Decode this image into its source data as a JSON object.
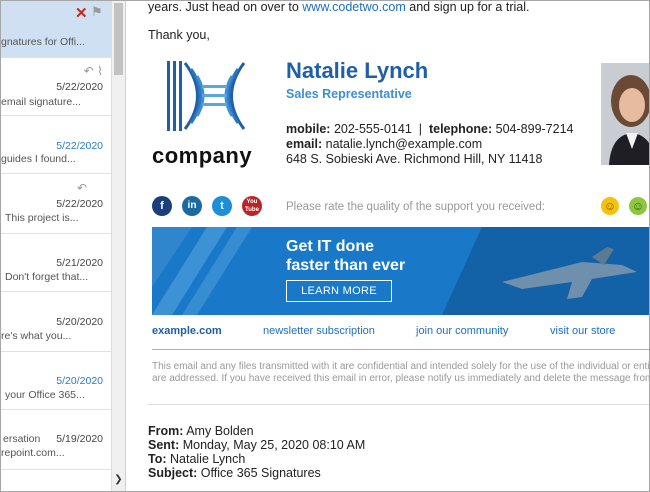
{
  "list": {
    "top_snippet": "gnatures for Offi...",
    "items": [
      {
        "date": "5/22/2020",
        "snippet": "email signature...",
        "date_blue": false
      },
      {
        "date": "5/22/2020",
        "snippet": "guides I found...",
        "date_blue": true
      },
      {
        "date": "5/22/2020",
        "snippet": "This project is...",
        "date_blue": false
      },
      {
        "date": "5/21/2020",
        "snippet": "Don't forget that...",
        "date_blue": false
      },
      {
        "date": "5/20/2020",
        "snippet": "re's what you...",
        "date_blue": false
      },
      {
        "date": "5/20/2020",
        "snippet": "your Office 365...",
        "date_blue": true
      },
      {
        "date": "5/19/2020",
        "sender": "ersation",
        "snippet": "repoint.com...",
        "date_blue": false
      }
    ]
  },
  "message": {
    "line1_prefix": "years. Just head on over to",
    "line1_link": "www.codetwo.com",
    "line1_suffix": "and sign up for a trial.",
    "thanks": "Thank you,"
  },
  "signature": {
    "company": "company",
    "name": "Natalie Lynch",
    "role": "Sales Representative",
    "mobile_label": "mobile:",
    "mobile": "202-555-0141",
    "divider": "|",
    "telephone_label": "telephone:",
    "telephone": "504-899-7214",
    "email_label": "email:",
    "email": "natalie.lynch@example.com",
    "address": "648 S. Sobieski Ave. Richmond Hill, NY 11418",
    "rate_text": "Please rate the quality of the support you received:",
    "banner_title_1": "Get IT done",
    "banner_title_2": "faster than ever",
    "banner_button": "LEARN MORE",
    "links": {
      "site": "example.com",
      "newsletter": "newsletter subscription",
      "community": "join our community",
      "store": "visit our store"
    },
    "disclaimer_1": "This email and any files transmitted with it are confidential and intended solely for the use of the individual or entity to",
    "disclaimer_2": "are addressed. If you have received this email in error, please notify us immediately and delete the message from yo",
    "social": {
      "facebook": "f",
      "linkedin": "in",
      "twitter": "t",
      "youtube": "You Tube"
    }
  },
  "header": {
    "from_label": "From:",
    "from": "Amy Bolden",
    "sent_label": "Sent:",
    "sent": "Monday, May 25, 2020 08:10 AM",
    "to_label": "To:",
    "to": "Natalie Lynch",
    "subject_label": "Subject:",
    "subject": "Office 365 Signatures"
  },
  "colors": {
    "brand_blue": "#1f5ea8",
    "accent_blue": "#3e8fd0",
    "link_blue": "#1f6fc0",
    "banner_blue": "#1a78c8",
    "delete_red": "#c42b1c",
    "selected_bg": "#cfe0f3"
  }
}
